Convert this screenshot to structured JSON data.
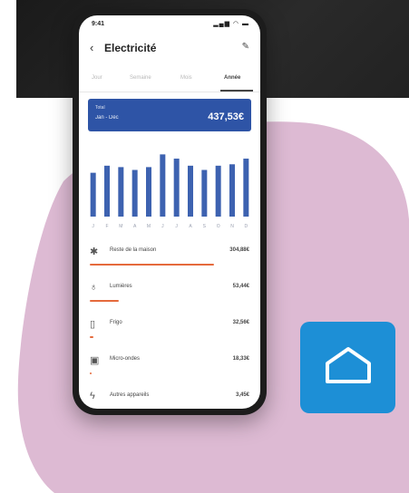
{
  "app": {
    "title": "Electricité",
    "status_time": "9:41",
    "status_icons": "▂▄▆ ◠ ▬"
  },
  "tabs": [
    {
      "label": "Jour",
      "active": false
    },
    {
      "label": "Semaine",
      "active": false
    },
    {
      "label": "Mois",
      "active": false
    },
    {
      "label": "Année",
      "active": true
    }
  ],
  "summary": {
    "label": "Total",
    "period": "Jan - Déc",
    "total": "437,53€",
    "color": "#2e54a6"
  },
  "chart_data": {
    "type": "bar",
    "categories": [
      "J",
      "F",
      "M",
      "A",
      "M",
      "J",
      "J",
      "A",
      "S",
      "O",
      "N",
      "D"
    ],
    "values": [
      62,
      72,
      70,
      66,
      70,
      88,
      82,
      72,
      66,
      72,
      74,
      82
    ],
    "ylim": [
      0,
      100
    ],
    "bar_color": "#3d62b0"
  },
  "devices": [
    {
      "name": "Reste de la maison",
      "value": "304,88€",
      "icon": "gear-icon",
      "glyph": "✱",
      "share": 0.78
    },
    {
      "name": "Lumières",
      "value": "53,44€",
      "icon": "lightbulb-icon",
      "glyph": "♁",
      "share": 0.18
    },
    {
      "name": "Frigo",
      "value": "32,56€",
      "icon": "fridge-icon",
      "glyph": "▯",
      "share": 0.02
    },
    {
      "name": "Micro-ondes",
      "value": "18,33€",
      "icon": "microwave-icon",
      "glyph": "▣",
      "share": 0.01
    },
    {
      "name": "Autres appareils",
      "value": "3,45€",
      "icon": "plug-icon",
      "glyph": "ϟ",
      "share": 0.01
    }
  ],
  "accent": {
    "orange": "#e56a3c",
    "blob": "#ddbad3",
    "tile": "#1d8fd6"
  }
}
